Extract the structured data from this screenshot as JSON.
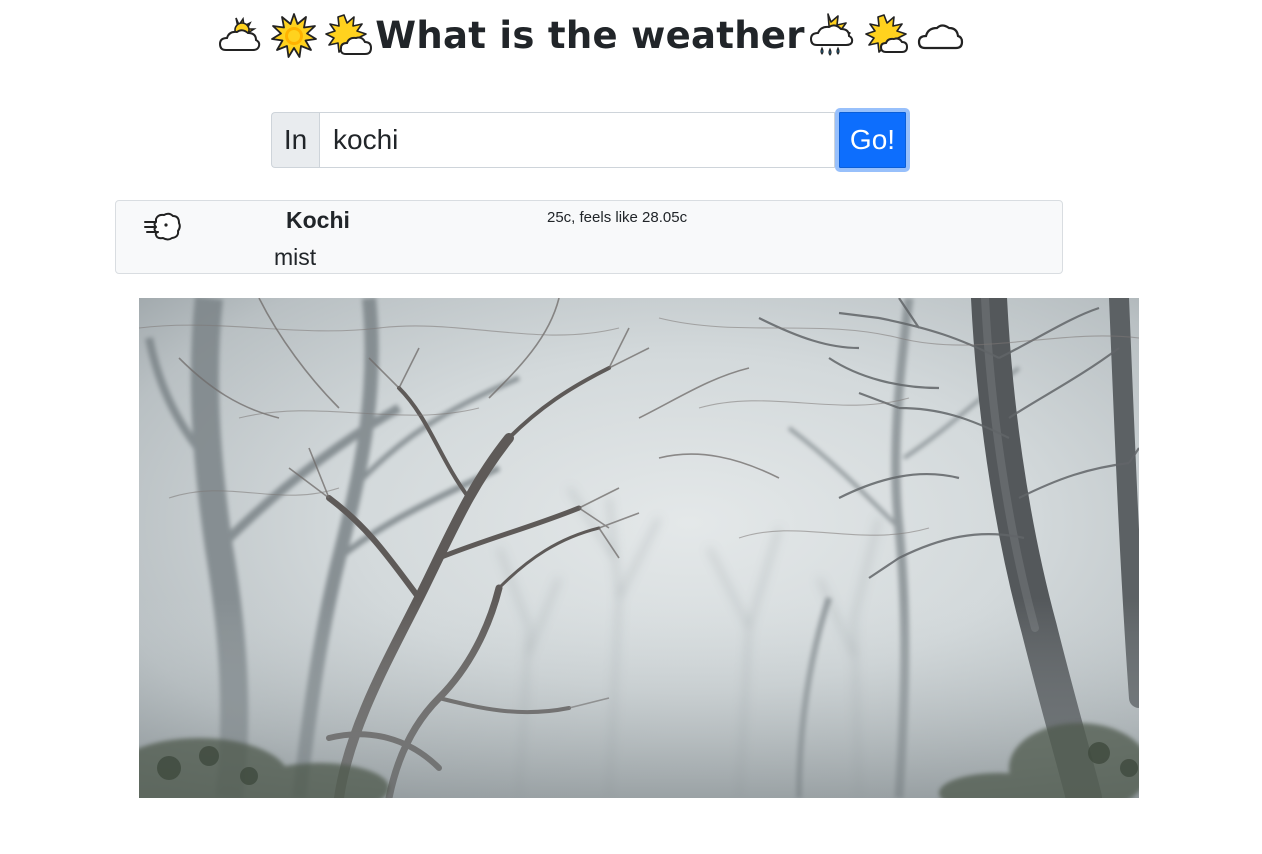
{
  "header": {
    "title": "What is the weather",
    "left_icons": [
      "sun-behind-cloud-icon",
      "sun-icon",
      "sun-behind-large-cloud-icon"
    ],
    "right_icons": [
      "sun-behind-rain-cloud-icon",
      "sun-behind-small-cloud-icon",
      "cloud-icon"
    ]
  },
  "search": {
    "prefix": "In",
    "value": "kochi",
    "button_label": "Go!"
  },
  "result": {
    "icon": "wind-face-icon",
    "city": "Kochi",
    "description": "mist",
    "temperature": "25c, feels like 28.05c"
  },
  "photo": {
    "subject": "misty-forest-image"
  },
  "colors": {
    "accent": "#0d6efd",
    "card_background": "#f8f9fa",
    "prefix_background": "#e9ecef",
    "text": "#212529"
  }
}
